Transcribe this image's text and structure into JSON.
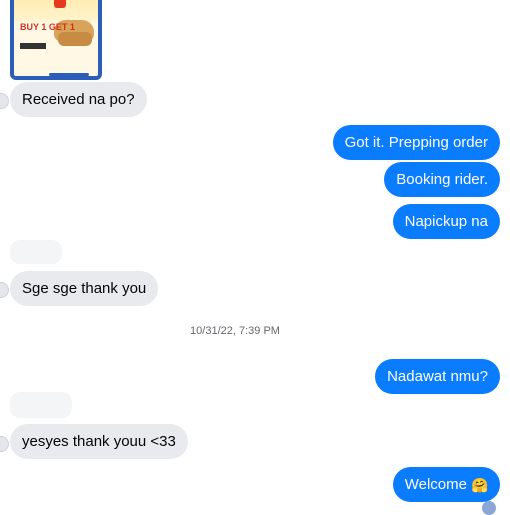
{
  "card": {
    "promo_text": "BUY 1 GET 1"
  },
  "messages": [
    {
      "side": "in",
      "text": "Received na po?"
    },
    {
      "side": "out",
      "text": "Got it. Prepping order"
    },
    {
      "side": "out",
      "text": "Booking rider."
    },
    {
      "side": "out",
      "text": "Napickup na"
    },
    {
      "side": "in",
      "text": "Sge sge thank you"
    },
    {
      "side": "out",
      "text": "Nadawat nmu?"
    },
    {
      "side": "in",
      "text": "yesyes thank youu <33"
    },
    {
      "side": "out",
      "text": "Welcome",
      "emoji": "🤗"
    }
  ],
  "timestamp": "10/31/22, 7:39 PM",
  "colors": {
    "outgoing": "#0a7cff",
    "incoming": "#e9eaed",
    "timestamp": "#65676b"
  }
}
